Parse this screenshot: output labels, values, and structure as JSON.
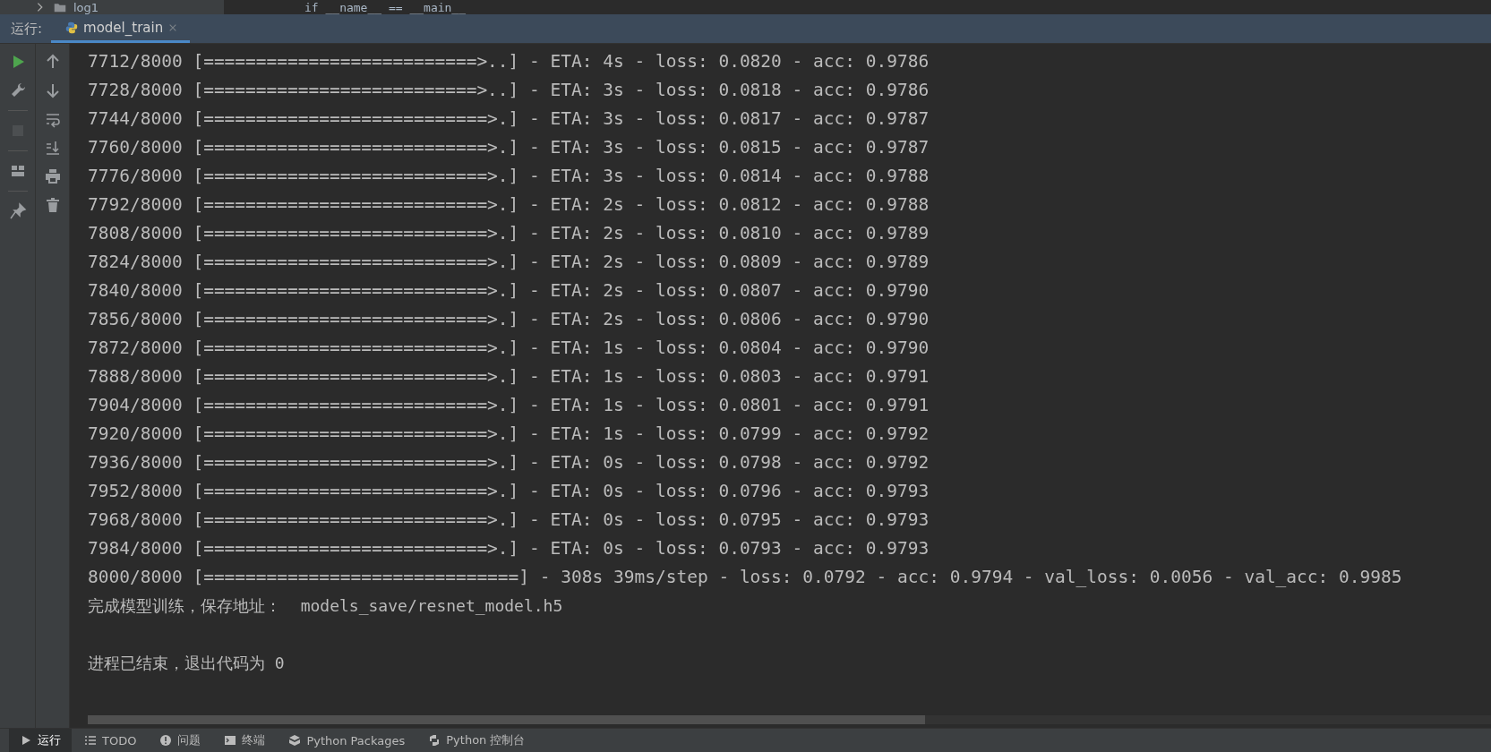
{
  "editor_strip": {
    "folder": "log1",
    "code": "if __name__ == __main__"
  },
  "run_panel": {
    "label": "运行:",
    "tabs": [
      {
        "label": "model_train",
        "selected": true
      }
    ]
  },
  "toolbar": [
    {
      "kind": "run",
      "disabled": false
    },
    {
      "kind": "wrench",
      "disabled": false
    },
    {
      "kind": "stop",
      "disabled": true
    },
    {
      "kind": "layout",
      "disabled": false
    },
    {
      "kind": "pin",
      "disabled": false
    }
  ],
  "toolbar_2": [
    {
      "kind": "up"
    },
    {
      "kind": "down"
    },
    {
      "kind": "wrap"
    },
    {
      "kind": "scroll-end"
    },
    {
      "kind": "print"
    },
    {
      "kind": "trash"
    }
  ],
  "console": [
    {
      "kind": "progress",
      "text": "7712/8000 [==========================>..] - ETA: 4s - loss: 0.0820 - acc: 0.9786"
    },
    {
      "kind": "progress",
      "text": "7728/8000 [==========================>..] - ETA: 3s - loss: 0.0818 - acc: 0.9786"
    },
    {
      "kind": "progress",
      "text": "7744/8000 [===========================>.] - ETA: 3s - loss: 0.0817 - acc: 0.9787"
    },
    {
      "kind": "progress",
      "text": "7760/8000 [===========================>.] - ETA: 3s - loss: 0.0815 - acc: 0.9787"
    },
    {
      "kind": "progress",
      "text": "7776/8000 [===========================>.] - ETA: 3s - loss: 0.0814 - acc: 0.9788"
    },
    {
      "kind": "progress",
      "text": "7792/8000 [===========================>.] - ETA: 2s - loss: 0.0812 - acc: 0.9788"
    },
    {
      "kind": "progress",
      "text": "7808/8000 [===========================>.] - ETA: 2s - loss: 0.0810 - acc: 0.9789"
    },
    {
      "kind": "progress",
      "text": "7824/8000 [===========================>.] - ETA: 2s - loss: 0.0809 - acc: 0.9789"
    },
    {
      "kind": "progress",
      "text": "7840/8000 [===========================>.] - ETA: 2s - loss: 0.0807 - acc: 0.9790"
    },
    {
      "kind": "progress",
      "text": "7856/8000 [===========================>.] - ETA: 2s - loss: 0.0806 - acc: 0.9790"
    },
    {
      "kind": "progress",
      "text": "7872/8000 [===========================>.] - ETA: 1s - loss: 0.0804 - acc: 0.9790"
    },
    {
      "kind": "progress",
      "text": "7888/8000 [===========================>.] - ETA: 1s - loss: 0.0803 - acc: 0.9791"
    },
    {
      "kind": "progress",
      "text": "7904/8000 [===========================>.] - ETA: 1s - loss: 0.0801 - acc: 0.9791"
    },
    {
      "kind": "progress",
      "text": "7920/8000 [===========================>.] - ETA: 1s - loss: 0.0799 - acc: 0.9792"
    },
    {
      "kind": "progress",
      "text": "7936/8000 [===========================>.] - ETA: 0s - loss: 0.0798 - acc: 0.9792"
    },
    {
      "kind": "progress",
      "text": "7952/8000 [===========================>.] - ETA: 0s - loss: 0.0796 - acc: 0.9793"
    },
    {
      "kind": "progress",
      "text": "7968/8000 [===========================>.] - ETA: 0s - loss: 0.0795 - acc: 0.9793"
    },
    {
      "kind": "progress",
      "text": "7984/8000 [===========================>.] - ETA: 0s - loss: 0.0793 - acc: 0.9793"
    },
    {
      "kind": "progress",
      "text": "8000/8000 [==============================] - 308s 39ms/step - loss: 0.0792 - acc: 0.9794 - val_loss: 0.0056 - val_acc: 0.9985"
    },
    {
      "kind": "info",
      "text": "完成模型训练，保存地址：  models_save/resnet_model.h5"
    },
    {
      "kind": "exit",
      "text": "进程已结束，退出代码为 0"
    }
  ],
  "bottom_tabs": [
    {
      "kind": "run",
      "label": "运行",
      "selected": true
    },
    {
      "kind": "list",
      "label": "TODO",
      "selected": false
    },
    {
      "kind": "alert",
      "label": "问题",
      "selected": false
    },
    {
      "kind": "terminal",
      "label": "终端",
      "selected": false
    },
    {
      "kind": "package",
      "label": "Python Packages",
      "selected": false
    },
    {
      "kind": "python",
      "label": "Python 控制台",
      "selected": false
    }
  ]
}
